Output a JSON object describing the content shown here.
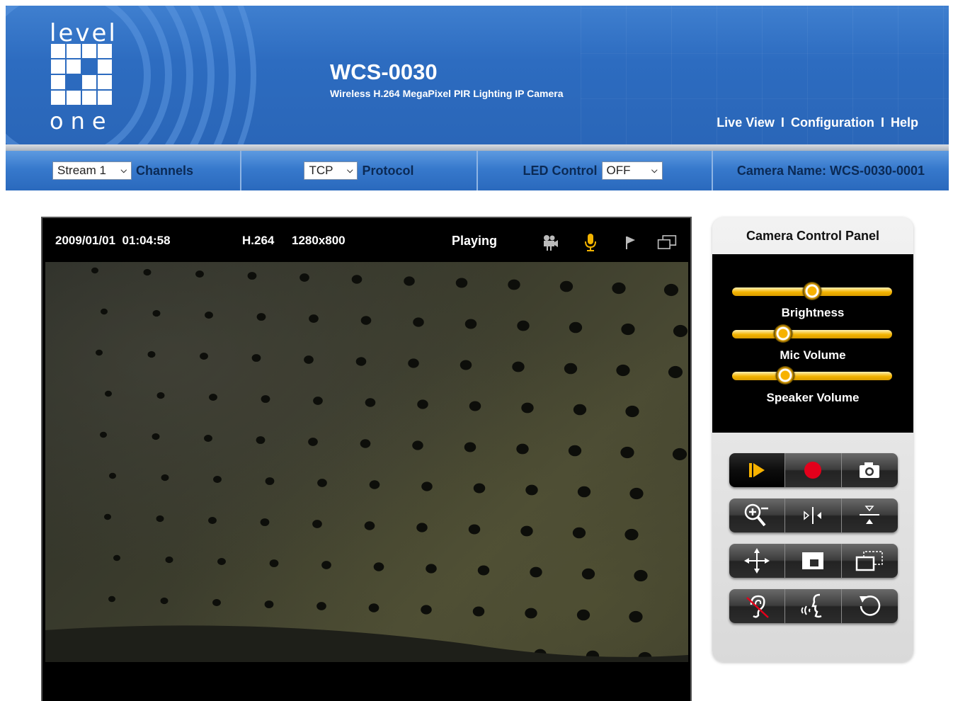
{
  "header": {
    "logo_top": "level",
    "logo_bottom": "one",
    "title": "WCS-0030",
    "subtitle": "Wireless H.264 MegaPixel PIR Lighting IP Camera",
    "nav": [
      {
        "label": "Live View"
      },
      {
        "label": "Configuration"
      },
      {
        "label": "Help"
      }
    ],
    "nav_separator": "I"
  },
  "toolbar": {
    "stream_value": "Stream 1",
    "channels_label": "Channels",
    "protocol_value": "TCP",
    "protocol_label": "Protocol",
    "led_label": "LED Control",
    "led_value": "OFF",
    "camera_name": "Camera Name: WCS-0030-0001"
  },
  "video": {
    "timestamp": "2009/01/01  01:04:58",
    "codec": "H.264",
    "resolution": "1280x800",
    "status": "Playing",
    "icons": [
      "video-camera-icon",
      "microphone-icon",
      "flag-icon",
      "window-icon"
    ]
  },
  "control_panel": {
    "title": "Camera Control Panel",
    "sliders": [
      {
        "label": "Brightness",
        "value": 0.5
      },
      {
        "label": "Mic Volume",
        "value": 0.32
      },
      {
        "label": "Speaker Volume",
        "value": 0.33
      }
    ],
    "buttons": [
      [
        "play-icon",
        "record-icon",
        "snapshot-icon"
      ],
      [
        "zoom-icon",
        "mirror-icon",
        "flip-icon"
      ],
      [
        "move-icon",
        "region-icon",
        "window-icon"
      ],
      [
        "listen-off-icon",
        "talk-icon",
        "reset-icon"
      ]
    ]
  },
  "colors": {
    "header_blue": "#2d6cc0",
    "toolbar_blue": "#3779cc",
    "slider_gold": "#f2b300",
    "record_red": "#e3001b",
    "play_gold": "#f7b200"
  }
}
